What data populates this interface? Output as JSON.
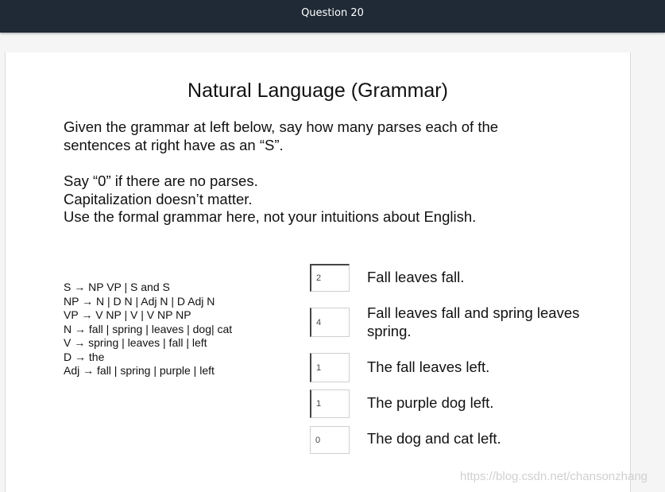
{
  "header": {
    "title": "Question 20"
  },
  "slide": {
    "title": "Natural Language (Grammar)",
    "instructions": [
      "Given the grammar at left below, say how many parses each of the",
      "sentences at right have as an “S”.",
      "Say “0” if there are no parses.",
      "Capitalization doesn’t matter.",
      "Use the formal grammar here, not your intuitions about English."
    ],
    "grammar": [
      "S → NP VP | S and S",
      "NP → N | D N | Adj N | D Adj N",
      "VP → V NP | V | V NP NP",
      "N → fall | spring | leaves | dog| cat",
      "V → spring | leaves | fall | left",
      "D → the",
      "Adj → fall | spring | purple | left"
    ],
    "questions": [
      {
        "answer": "2",
        "sentence_lines": [
          "Fall leaves fall."
        ]
      },
      {
        "answer": "4",
        "sentence_lines": [
          "Fall leaves fall and spring leaves",
          "spring."
        ]
      },
      {
        "answer": "1",
        "sentence_lines": [
          "The fall leaves left."
        ]
      },
      {
        "answer": "1",
        "sentence_lines": [
          "The purple dog left."
        ]
      },
      {
        "answer": "0",
        "sentence_lines": [
          "The dog and cat left."
        ]
      }
    ]
  },
  "watermark": "https://blog.csdn.net/chansonzhang"
}
